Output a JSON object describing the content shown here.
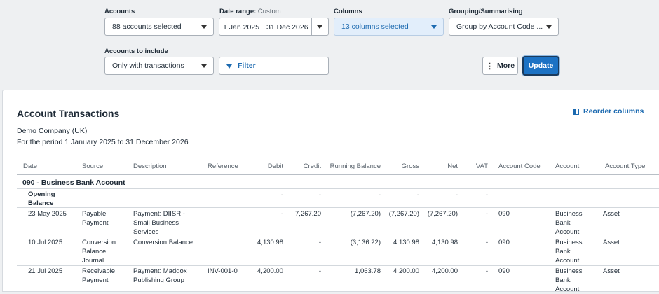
{
  "filters": {
    "accounts": {
      "label": "Accounts",
      "value": "88 accounts selected"
    },
    "date_range": {
      "label": "Date range:",
      "sublabel": "Custom",
      "start": "1 Jan 2025",
      "end": "31 Dec 2026"
    },
    "columns": {
      "label": "Columns",
      "value": "13 columns selected"
    },
    "grouping": {
      "label": "Grouping/Summarising",
      "value": "Group by Account Code ..."
    },
    "accounts_include": {
      "label": "Accounts to include",
      "value": "Only with transactions"
    },
    "filter_label": "Filter",
    "more_label": "More",
    "update_label": "Update"
  },
  "report": {
    "title": "Account Transactions",
    "reorder_label": "Reorder columns",
    "company": "Demo Company (UK)",
    "period": "For the period 1 January 2025 to 31 December 2026",
    "headers": [
      "Date",
      "Source",
      "Description",
      "Reference",
      "Debit",
      "Credit",
      "Running Balance",
      "Gross",
      "Net",
      "VAT",
      "Account Code",
      "Account",
      "Account Type"
    ],
    "section_title": "090 - Business Bank Account",
    "opening": {
      "label_line1": "Opening",
      "label_line2": "Balance",
      "debit": "-",
      "credit": "-",
      "running": "-",
      "gross": "-",
      "net": "-",
      "vat": "-"
    },
    "rows": [
      {
        "date": "23 May 2025",
        "source": [
          "Payable",
          "Payment"
        ],
        "description": [
          "Payment: DIISR -",
          "Small Business",
          "Services"
        ],
        "reference": "",
        "debit": "-",
        "credit": "7,267.20",
        "running": "(7,267.20)",
        "gross": "(7,267.20)",
        "net": "(7,267.20)",
        "vat": "-",
        "code": "090",
        "account": [
          "Business",
          "Bank",
          "Account"
        ],
        "type": "Asset"
      },
      {
        "date": "10 Jul 2025",
        "source": [
          "Conversion",
          "Balance",
          "Journal"
        ],
        "description": [
          "Conversion Balance"
        ],
        "reference": "",
        "debit": "4,130.98",
        "credit": "-",
        "running": "(3,136.22)",
        "gross": "4,130.98",
        "net": "4,130.98",
        "vat": "-",
        "code": "090",
        "account": [
          "Business",
          "Bank",
          "Account"
        ],
        "type": "Asset"
      },
      {
        "date": "21 Jul 2025",
        "source": [
          "Receivable",
          "Payment"
        ],
        "description": [
          "Payment: Maddox",
          "Publishing Group"
        ],
        "reference": "INV-001-0",
        "debit": "4,200.00",
        "credit": "-",
        "running": "1,063.78",
        "gross": "4,200.00",
        "net": "4,200.00",
        "vat": "-",
        "code": "090",
        "account": [
          "Business",
          "Bank",
          "Account"
        ],
        "type": "Asset"
      }
    ]
  }
}
